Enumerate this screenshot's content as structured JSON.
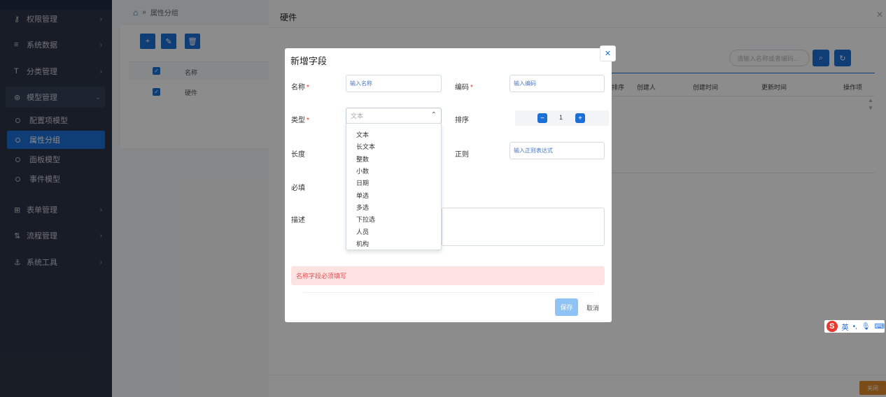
{
  "sidebar": {
    "items": [
      {
        "icon": "key-icon",
        "glyph": "⚷",
        "label": "权限管理"
      },
      {
        "icon": "list-icon",
        "glyph": "≡",
        "label": "系统数据"
      },
      {
        "icon": "type-icon",
        "glyph": "T",
        "label": "分类管理"
      },
      {
        "icon": "model-icon",
        "glyph": "⊛",
        "label": "模型管理"
      },
      {
        "icon": "grid-icon",
        "glyph": "⊞",
        "label": "表单管理"
      },
      {
        "icon": "flow-icon",
        "glyph": "⇅",
        "label": "流程管理"
      },
      {
        "icon": "anchor-icon",
        "glyph": "⚓",
        "label": "系统工具"
      }
    ],
    "subitems": [
      "配置项模型",
      "属性分组",
      "面板模型",
      "事件模型"
    ]
  },
  "breadcrumb": {
    "separator": "»",
    "current": "属性分组"
  },
  "list": {
    "header": "名称",
    "rows": [
      "硬件"
    ]
  },
  "drawer": {
    "title": "硬件",
    "search_placeholder": "请输入名称或者编码...",
    "columns": [
      "排序",
      "创建人",
      "创建时间",
      "更新时间",
      "操作项"
    ],
    "close_label": "关闭"
  },
  "modal": {
    "title": "新增字段",
    "fields": {
      "name_label": "名称",
      "name_placeholder": "输入名称",
      "code_label": "编码",
      "code_placeholder": "输入编码",
      "type_label": "类型",
      "type_placeholder": "文本",
      "sort_label": "排序",
      "sort_value": "1",
      "length_label": "长度",
      "regex_label": "正则",
      "regex_placeholder": "输入正则表达式",
      "required_label": "必填",
      "desc_label": "描述"
    },
    "type_options": [
      "文本",
      "长文本",
      "整数",
      "小数",
      "日期",
      "单选",
      "多选",
      "下拉选",
      "人员",
      "机构"
    ],
    "error_message": "名称字段必须填写",
    "save_label": "保存",
    "cancel_label": "取消"
  },
  "ime": {
    "mode": "英",
    "punct": "•,"
  }
}
